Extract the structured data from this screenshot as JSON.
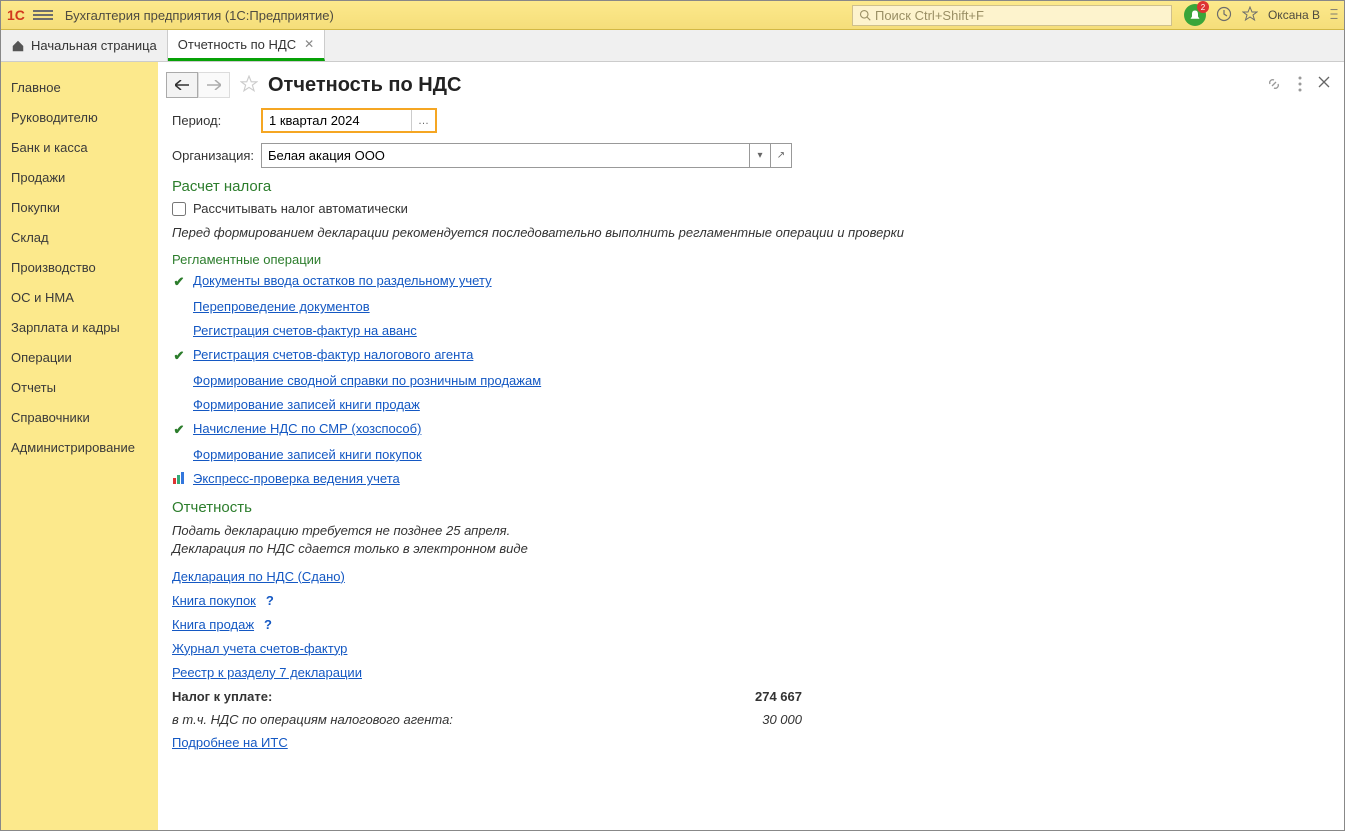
{
  "titlebar": {
    "logo": "1С",
    "app_title": "Бухгалтерия предприятия  (1С:Предприятие)",
    "search_placeholder": "Поиск Ctrl+Shift+F",
    "badge": "2",
    "username": "Оксана В"
  },
  "tabs": {
    "home": "Начальная страница",
    "current": "Отчетность по НДС"
  },
  "sidebar": [
    "Главное",
    "Руководителю",
    "Банк и касса",
    "Продажи",
    "Покупки",
    "Склад",
    "Производство",
    "ОС и НМА",
    "Зарплата и кадры",
    "Операции",
    "Отчеты",
    "Справочники",
    "Администрирование"
  ],
  "page": {
    "title": "Отчетность по НДС",
    "period_label": "Период:",
    "period_value": "1 квартал 2024",
    "org_label": "Организация:",
    "org_value": "Белая акация ООО"
  },
  "calc": {
    "title": "Расчет налога",
    "checkbox": "Рассчитывать налог автоматически",
    "note": "Перед формированием декларации рекомендуется последовательно выполнить регламентные операции и проверки"
  },
  "regops": {
    "title": "Регламентные операции",
    "items": [
      {
        "icon": "check",
        "text": "Документы ввода остатков по раздельному учету"
      },
      {
        "icon": "",
        "text": "Перепроведение документов"
      },
      {
        "icon": "",
        "text": "Регистрация счетов-фактур на аванс"
      },
      {
        "icon": "check",
        "text": "Регистрация счетов-фактур налогового агента"
      },
      {
        "icon": "",
        "text": "Формирование сводной справки по розничным продажам"
      },
      {
        "icon": "",
        "text": "Формирование записей книги продаж"
      },
      {
        "icon": "check",
        "text": "Начисление НДС по СМР (хозспособ)"
      },
      {
        "icon": "",
        "text": "Формирование записей книги покупок"
      },
      {
        "icon": "report",
        "text": "Экспресс-проверка ведения учета"
      }
    ]
  },
  "reporting": {
    "title": "Отчетность",
    "note1": "Подать декларацию требуется не позднее 25 апреля.",
    "note2": "Декларация по НДС сдается только в электронном виде",
    "links": [
      {
        "text": "Декларация по НДС (Сдано)",
        "q": false
      },
      {
        "text": "Книга покупок",
        "q": true
      },
      {
        "text": "Книга продаж",
        "q": true
      },
      {
        "text": "Журнал учета счетов-фактур",
        "q": false
      },
      {
        "text": "Реестр к разделу 7 декларации",
        "q": false
      }
    ],
    "tax_label": "Налог к уплате:",
    "tax_value": "274 667",
    "agent_label": "в т.ч. НДС по операциям налогового агента:",
    "agent_value": "30 000",
    "more": "Подробнее на ИТС"
  }
}
